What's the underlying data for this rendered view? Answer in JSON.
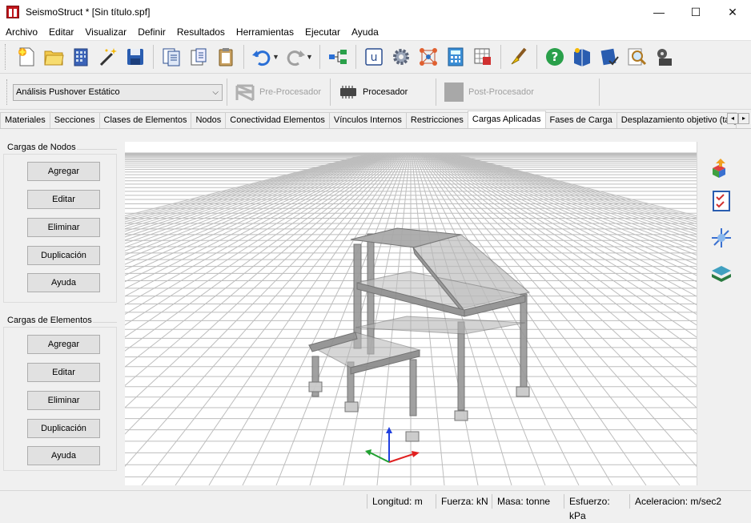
{
  "window": {
    "title": "SeismoStruct * [Sin título.spf]",
    "minimize": "—",
    "maximize": "☐",
    "close": "✕"
  },
  "menu": [
    "Archivo",
    "Editar",
    "Visualizar",
    "Definir",
    "Resultados",
    "Herramientas",
    "Ejecutar",
    "Ayuda"
  ],
  "toolbar": {
    "icons": [
      "new-project-icon",
      "open-folder-icon",
      "building-icon",
      "wizard-icon",
      "save-icon",
      "copy-document-icon",
      "paste-document-icon",
      "clipboard-icon",
      "undo-icon",
      "redo-icon",
      "hierarchy-icon",
      "unit-u-icon",
      "settings-gear-icon",
      "molecule-icon",
      "calculator-icon",
      "table-grid-icon",
      "brush-icon",
      "help-icon",
      "book-icon",
      "manual-icon",
      "search-icon",
      "film-icon"
    ]
  },
  "analysis": {
    "type": "Análisis Pushover Estático",
    "pre_processor": "Pre-Procesador",
    "processor": "Procesador",
    "post_processor": "Post-Procesador"
  },
  "tabs": {
    "items": [
      "Materiales",
      "Secciones",
      "Clases de Elementos",
      "Nodos",
      "Conectividad Elementos",
      "Vínculos Internos",
      "Restricciones",
      "Cargas Aplicadas",
      "Fases de Carga",
      "Desplazamiento objetivo (targe"
    ],
    "active": "Cargas Aplicadas",
    "scroll_left": "◂",
    "scroll_right": "▸"
  },
  "node_loads": {
    "title": "Cargas de Nodos",
    "buttons": [
      "Agregar",
      "Editar",
      "Eliminar",
      "Duplicación",
      "Ayuda"
    ]
  },
  "element_loads": {
    "title": "Cargas de Elementos",
    "buttons": [
      "Agregar",
      "Editar",
      "Eliminar",
      "Duplicación",
      "Ayuda"
    ]
  },
  "sidebar": {
    "icons": [
      "3d-view-icon",
      "checklist-icon",
      "axes-icon",
      "layers-icon"
    ]
  },
  "status": {
    "length": "Longitud: m",
    "force": "Fuerza: kN",
    "mass": "Masa: tonne",
    "stress": "Esfuerzo: kPa",
    "acceleration": "Aceleracion: m/sec2"
  },
  "colors": {
    "frame": "#8a8a8a",
    "grid": "#bdbdbd",
    "axis_x": "#e02020",
    "axis_y": "#20a030",
    "axis_z": "#2040e0"
  }
}
